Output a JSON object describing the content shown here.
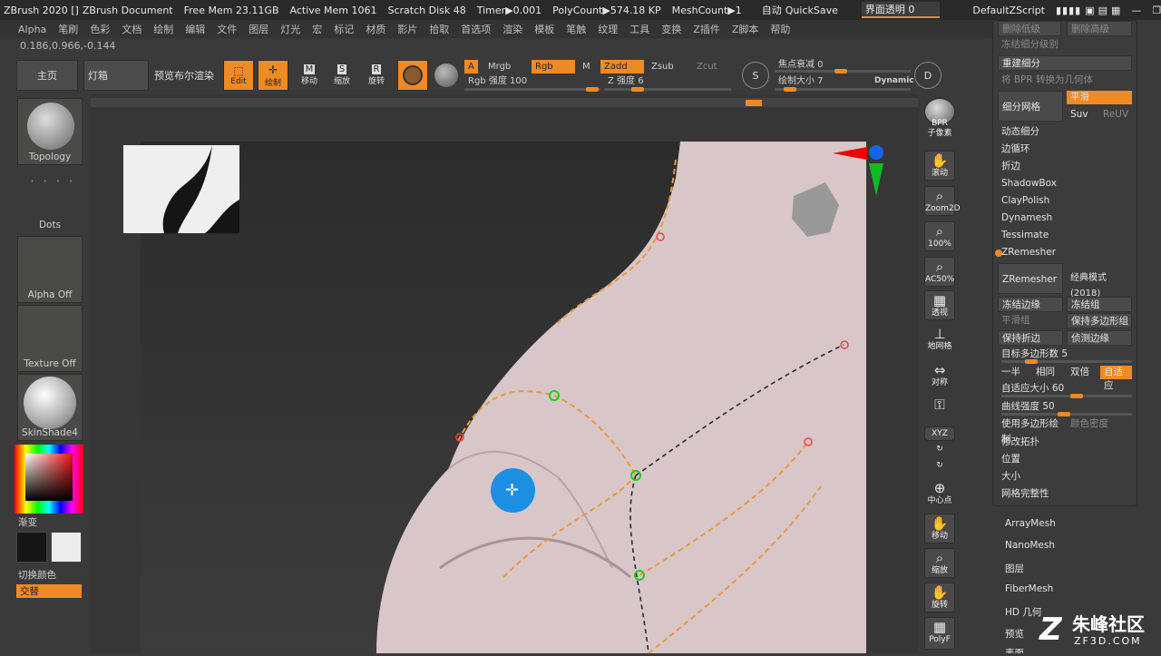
{
  "titlebar": {
    "app": "ZBrush 2020 []",
    "doc": "ZBrush Document",
    "free_mem": "Free Mem 23.11GB",
    "active_mem": "Active Mem 1061",
    "scratch": "Scratch Disk 48",
    "timer": "Timer▶0.001",
    "polycount": "PolyCount▶574.18 KP",
    "meshcount": "MeshCount▶1",
    "auto": "自动",
    "quicksave": "QuickSave",
    "transparency": "界面透明 0",
    "script": "DefaultZScript"
  },
  "menu": [
    "Alpha",
    "笔刷",
    "色彩",
    "文档",
    "绘制",
    "编辑",
    "文件",
    "图层",
    "灯光",
    "宏",
    "标记",
    "材质",
    "影片",
    "拾取",
    "首选项",
    "渲染",
    "模板",
    "笔触",
    "纹理",
    "工具",
    "变换",
    "Z插件",
    "Z脚本",
    "帮助"
  ],
  "coords": "0.186,0.966,-0.144",
  "toolbar": {
    "home": "主页",
    "lightbox": "灯箱",
    "bpr_preview": "预览布尔渲染",
    "edit": "Edit",
    "draw": "绘制",
    "move": "移动",
    "scale": "缩放",
    "rotate": "旋转",
    "move_letter": "M",
    "scale_letter": "S",
    "rotate_letter": "R",
    "a": "A",
    "mrgb": "Mrgb",
    "rgb": "Rgb",
    "m": "M",
    "zadd": "Zadd",
    "zsub": "Zsub",
    "zcut": "Zcut",
    "rgb_intensity": "Rgb 强度 100",
    "z_intensity": "Z 强度 6",
    "focal_shift": "焦点衰减 0",
    "draw_size": "绘制大小 7",
    "dynamic": "Dynamic",
    "s": "S",
    "d": "D"
  },
  "left": {
    "topology": "Topology",
    "dots": "Dots",
    "alpha": "Alpha Off",
    "texture": "Texture Off",
    "material": "SkinShade4",
    "gradient": "渐变",
    "switch_color": "切换颜色",
    "alternate": "交替"
  },
  "right_shelf": [
    {
      "name": "bpr",
      "icon": "●",
      "label": "BPR"
    },
    {
      "name": "subpixel",
      "icon": "",
      "label": "子像素"
    },
    {
      "name": "scroll",
      "icon": "✋",
      "label": "滚动"
    },
    {
      "name": "zoom2d",
      "icon": "🔍",
      "label": "Zoom2D"
    },
    {
      "name": "zoom100",
      "icon": "🔍",
      "label": "100%"
    },
    {
      "name": "ac50",
      "icon": "🔍",
      "label": "AC50%"
    },
    {
      "name": "perspective",
      "icon": "▦",
      "label": "透视"
    },
    {
      "name": "floor",
      "icon": "⊥",
      "label": "地网格"
    },
    {
      "name": "symmetry",
      "icon": "⇔",
      "label": "对称"
    },
    {
      "name": "local",
      "icon": "🔒",
      "label": ""
    },
    {
      "name": "xyz",
      "icon": "",
      "label": "XYZ"
    },
    {
      "name": "rot1",
      "icon": "↻",
      "label": ""
    },
    {
      "name": "rot2",
      "icon": "↻",
      "label": ""
    },
    {
      "name": "center",
      "icon": "⊕",
      "label": "中心点"
    },
    {
      "name": "move",
      "icon": "✋",
      "label": "移动"
    },
    {
      "name": "scale",
      "icon": "🔍",
      "label": "缩放"
    },
    {
      "name": "rotate",
      "icon": "✋",
      "label": "旋转"
    },
    {
      "name": "polyf",
      "icon": "▦",
      "label": "PolyF"
    }
  ],
  "panel": {
    "delete_lower": "删除低级",
    "delete_higher": "删除高级",
    "freeze_sub": "冻结细分级别",
    "rebuild_sub": "重建细分",
    "bpr_to_geo": "将 BPR 转换为几何体",
    "subdivide": "细分网格",
    "smooth": "平滑",
    "suv": "Suv",
    "reuv": "ReUV",
    "dynamic_sub": "动态细分",
    "edgeloop": "边循环",
    "crease": "折边",
    "shadowbox": "ShadowBox",
    "claypolish": "ClayPolish",
    "dynamesh": "Dynamesh",
    "tessimate": "Tessimate",
    "zremesher_header": "ZRemesher",
    "zremesher_btn": "ZRemesher",
    "classic": "经典模式(2018)",
    "freeze_border": "冻结边缘",
    "freeze_groups": "冻结组",
    "smooth_groups": "平滑组",
    "keep_groups": "保持多边形组",
    "keep_creases": "保持折边",
    "detect_edges": "侦测边缘",
    "target_count": "目标多边形数 5",
    "half": "一半",
    "same": "相同",
    "double": "双倍",
    "adapt": "自适应",
    "adaptive_size": "自适应大小 60",
    "curve_strength": "曲线强度 50",
    "use_polypaint": "使用多边形绘制",
    "color_density": "颜色密度",
    "modify_topology": "修改拓扑",
    "position": "位置",
    "size": "大小",
    "mesh_integrity": "网格完整性"
  },
  "lower_list": [
    "ArrayMesh",
    "NanoMesh",
    "图层",
    "FiberMesh",
    "HD 几何",
    "预览",
    "表面"
  ],
  "watermark": {
    "title": "朱峰社区",
    "url": "ZF3D.COM"
  }
}
